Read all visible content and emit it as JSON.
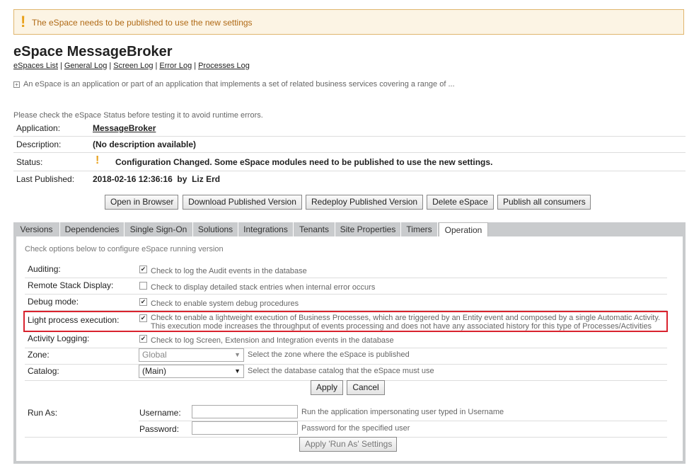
{
  "banner": {
    "text": "The eSpace needs to be published to use the new settings"
  },
  "header": {
    "title": "eSpace MessageBroker",
    "links": [
      "eSpaces List",
      "General Log",
      "Screen Log",
      "Error Log",
      "Processes Log"
    ],
    "description": "An eSpace is an application or part of an application that implements a set of related business services covering a range of ..."
  },
  "info": {
    "note": "Please check the eSpace Status before testing it to avoid runtime errors.",
    "application_label": "Application:",
    "application_value": "MessageBroker",
    "description_label": "Description:",
    "description_value": "(No description available)",
    "status_label": "Status:",
    "status_value": "Configuration Changed. Some eSpace modules need to be published to use the new settings.",
    "published_label": "Last Published:",
    "published_value": "2018-02-16 12:36:16  by  Liz Erd"
  },
  "actions": {
    "open": "Open in Browser",
    "download": "Download Published Version",
    "redeploy": "Redeploy Published Version",
    "delete": "Delete eSpace",
    "publish_consumers": "Publish all consumers"
  },
  "tabs": [
    "Versions",
    "Dependencies",
    "Single Sign-On",
    "Solutions",
    "Integrations",
    "Tenants",
    "Site Properties",
    "Timers",
    "Operation"
  ],
  "active_tab": "Operation",
  "operation": {
    "note": "Check options below to configure eSpace running version",
    "auditing_label": "Auditing:",
    "auditing_text": "Check to log the Audit events in the database",
    "auditing_checked": true,
    "remote_label": "Remote Stack Display:",
    "remote_text": "Check to display detailed stack entries when internal error occurs",
    "remote_checked": false,
    "debug_label": "Debug mode:",
    "debug_text": "Check to enable system debug procedures",
    "debug_checked": true,
    "light_label": "Light process execution:",
    "light_text_1": "Check to enable a lightweight execution of Business Processes, which are triggered by an Entity event and composed by a single Automatic Activity.",
    "light_text_2": "This execution mode increases the throughput of events processing and does not have any associated history for this type of Processes/Activities",
    "light_checked": true,
    "activity_label": "Activity Logging:",
    "activity_text": "Check to log Screen, Extension and Integration events in the database",
    "activity_checked": true,
    "zone_label": "Zone:",
    "zone_value": "Global",
    "zone_text": "Select the zone where the eSpace is published",
    "catalog_label": "Catalog:",
    "catalog_value": "(Main)",
    "catalog_text": "Select the database catalog that the eSpace must use",
    "apply": "Apply",
    "cancel": "Cancel",
    "runas_label": "Run As:",
    "username_label": "Username:",
    "username_value": "",
    "username_text": "Run the application impersonating user typed in Username",
    "password_label": "Password:",
    "password_value": "",
    "password_text": "Password for the specified user",
    "runas_apply": "Apply 'Run As' Settings"
  },
  "colors": {
    "warning": "#e8a01a",
    "highlight": "#d9232e",
    "tab_bar": "#c9cbcd"
  }
}
